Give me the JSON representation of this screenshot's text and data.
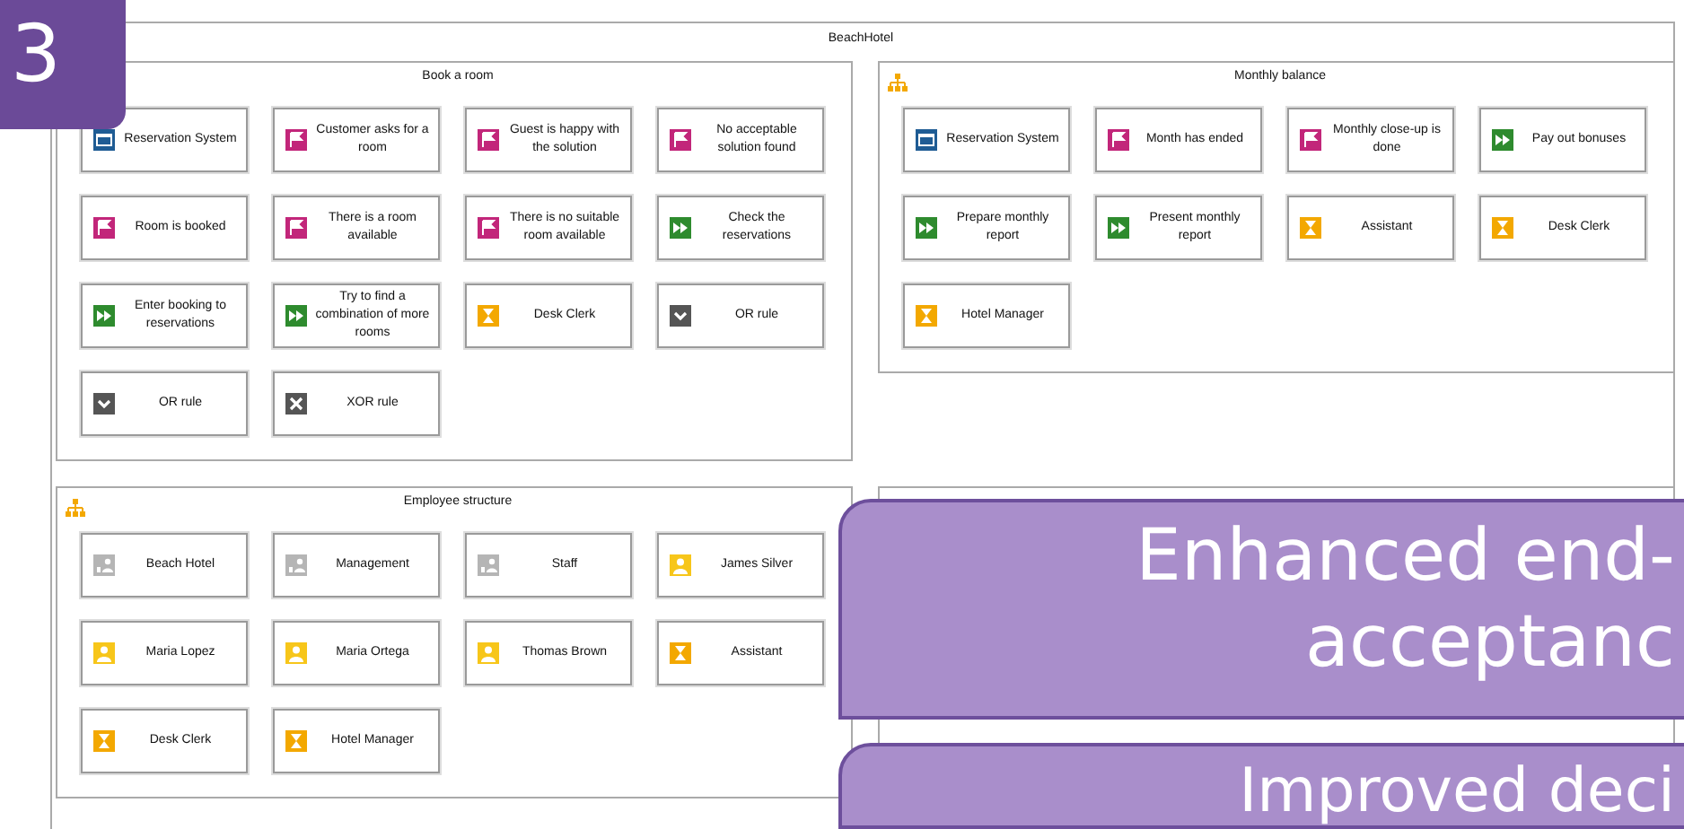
{
  "slide_number": "3",
  "diagram": {
    "title": "BeachHotel",
    "panels": [
      {
        "title": "Book a room",
        "items": [
          {
            "kind": "system",
            "label": "Reservation System"
          },
          {
            "kind": "event",
            "label": "Customer asks for a room"
          },
          {
            "kind": "event",
            "label": "Guest is happy with the solution"
          },
          {
            "kind": "event",
            "label": "No acceptable solution found"
          },
          {
            "kind": "event",
            "label": "Room is booked"
          },
          {
            "kind": "event",
            "label": "There is a room available"
          },
          {
            "kind": "event",
            "label": "There is no suitable room available"
          },
          {
            "kind": "function",
            "label": "Check the reservations"
          },
          {
            "kind": "function",
            "label": "Enter booking to reservations"
          },
          {
            "kind": "function",
            "label": "Try to find a combination of more rooms"
          },
          {
            "kind": "role",
            "label": "Desk Clerk"
          },
          {
            "kind": "rule_or",
            "label": "OR rule"
          },
          {
            "kind": "rule_or",
            "label": "OR rule"
          },
          {
            "kind": "rule_xor",
            "label": "XOR rule"
          }
        ]
      },
      {
        "title": "Monthly balance",
        "org_icon": true,
        "items": [
          {
            "kind": "system",
            "label": "Reservation System"
          },
          {
            "kind": "event",
            "label": "Month has ended"
          },
          {
            "kind": "event",
            "label": "Monthly close-up is done"
          },
          {
            "kind": "function",
            "label": "Pay out bonuses"
          },
          {
            "kind": "function",
            "label": "Prepare monthly report"
          },
          {
            "kind": "function",
            "label": "Present monthly report"
          },
          {
            "kind": "role",
            "label": "Assistant"
          },
          {
            "kind": "role",
            "label": "Desk Clerk"
          },
          {
            "kind": "role",
            "label": "Hotel Manager"
          }
        ]
      },
      {
        "title": "Employee structure",
        "org_icon": true,
        "items": [
          {
            "kind": "org_unit",
            "label": "Beach Hotel"
          },
          {
            "kind": "org_unit",
            "label": "Management"
          },
          {
            "kind": "org_unit",
            "label": "Staff"
          },
          {
            "kind": "person",
            "label": "James Silver"
          },
          {
            "kind": "person",
            "label": "Maria Lopez"
          },
          {
            "kind": "person",
            "label": "Maria Ortega"
          },
          {
            "kind": "person",
            "label": "Thomas Brown"
          },
          {
            "kind": "role",
            "label": "Assistant"
          },
          {
            "kind": "role",
            "label": "Desk Clerk"
          },
          {
            "kind": "role",
            "label": "Hotel Manager"
          }
        ]
      }
    ]
  },
  "callouts": [
    {
      "lines": [
        "Enhanced end-",
        "acceptanc"
      ]
    },
    {
      "lines": [
        "Improved deci"
      ]
    }
  ]
}
